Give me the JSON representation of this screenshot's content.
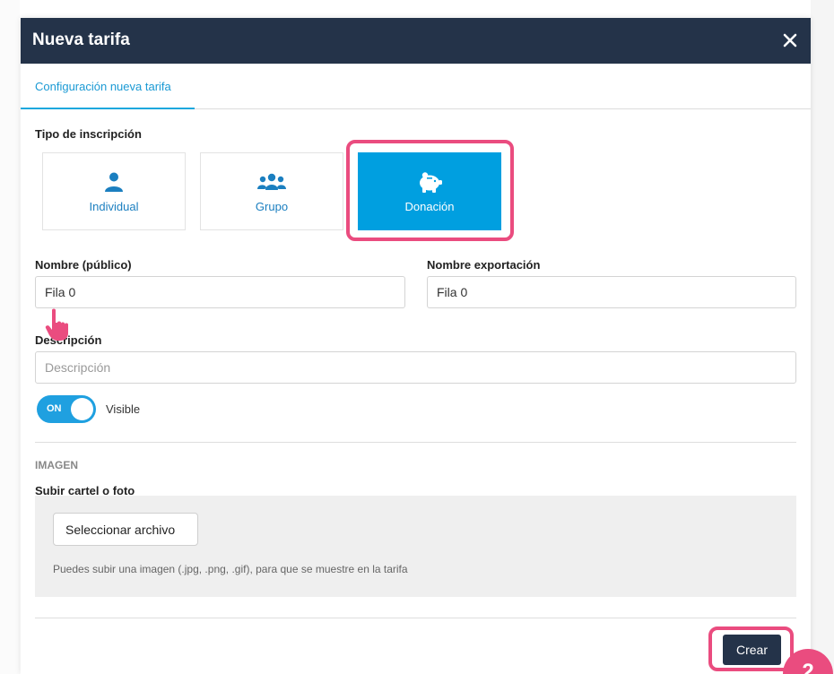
{
  "modal": {
    "title": "Nueva tarifa"
  },
  "tabs": [
    {
      "label": "Configuración nueva tarifa",
      "active": true
    }
  ],
  "registration_type": {
    "label": "Tipo de inscripción",
    "options": [
      {
        "label": "Individual",
        "icon": "person-icon",
        "selected": false
      },
      {
        "label": "Grupo",
        "icon": "group-icon",
        "selected": false
      },
      {
        "label": "Donación",
        "icon": "piggy-bank-icon",
        "selected": true
      }
    ]
  },
  "fields": {
    "public_name": {
      "label": "Nombre (público)",
      "value": "Fila 0"
    },
    "export_name": {
      "label": "Nombre exportación",
      "value": "Fila 0"
    },
    "description": {
      "label": "Descripción",
      "placeholder": "Descripción",
      "value": ""
    }
  },
  "visibility": {
    "toggle_state": "ON",
    "label": "Visible"
  },
  "image": {
    "section_title": "IMAGEN",
    "label": "Subir cartel o foto",
    "button_label": "Seleccionar archivo",
    "help_text": "Puedes subir una imagen (.jpg, .png, .gif), para que se muestre en la tarifa"
  },
  "actions": {
    "create_label": "Crear"
  },
  "annotation": {
    "step_number": "2"
  },
  "colors": {
    "header": "#243349",
    "accent": "#009fe0",
    "highlight": "#ea4c7f"
  }
}
